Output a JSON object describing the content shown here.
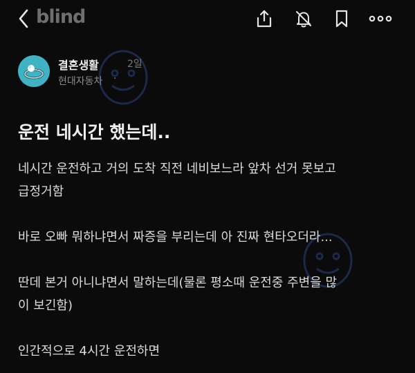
{
  "header": {
    "brand": "blind",
    "icons": [
      "back-icon",
      "share-icon",
      "notification-off-icon",
      "bookmark-icon",
      "more-icon"
    ]
  },
  "author": {
    "name": "결혼생활",
    "time": "2일",
    "company": "현대자동차",
    "separator": "·"
  },
  "post": {
    "title": "운전 네시간 했는데..",
    "lines": [
      "네시간 운전하고 거의 도착 직전  네비보느라 앞차 선거 못보고",
      "급정거함",
      "바로 오빠 뭐하냐면서 짜증을 부리는데 아 진짜 현타오더라...",
      "딴데 본거 아니냐면서  말하는데(물론 평소때 운전중 주변을 많",
      "이 보긴함)",
      "인간적으로 4시간 운전하면"
    ]
  },
  "colors": {
    "background": "#0b0b0b",
    "avatar": "#3fb3c4",
    "brand": "#6f6f6f"
  }
}
